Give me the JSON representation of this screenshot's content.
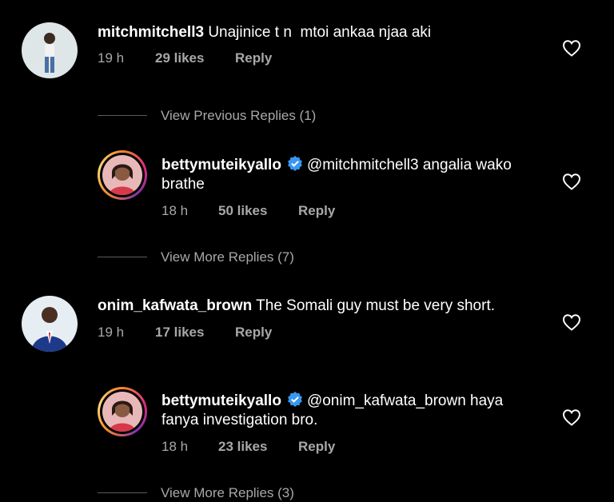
{
  "comments": [
    {
      "username": "mitchmitchell3",
      "text": "Unajinice t n  mtoi ankaa njaa aki",
      "time": "19 h",
      "likes": "29 likes",
      "reply": "Reply"
    },
    {
      "username": "onim_kafwata_brown",
      "text": "The Somali guy must be very short.",
      "time": "19 h",
      "likes": "17 likes",
      "reply": "Reply"
    }
  ],
  "replies": [
    {
      "username": "bettymuteikyallo",
      "text_line1": "@mitchmitchell3 angalia wako",
      "text_line2": "brathe",
      "time": "18 h",
      "likes": "50 likes",
      "reply": "Reply"
    },
    {
      "username": "bettymuteikyallo",
      "text_line1": "@onim_kafwata_brown haya",
      "text_line2": "fanya investigation bro.",
      "time": "18 h",
      "likes": "23 likes",
      "reply": "Reply"
    }
  ],
  "view_links": {
    "previous_1": "View Previous Replies (1)",
    "more_1": "View More Replies (7)",
    "more_2": "View More Replies (3)"
  },
  "icons": {
    "like": "heart-outline-icon",
    "verified": "verified-badge-icon"
  },
  "colors": {
    "background": "#000000",
    "secondary_text": "#a8a8a8",
    "verified_blue": "#3897f0"
  }
}
